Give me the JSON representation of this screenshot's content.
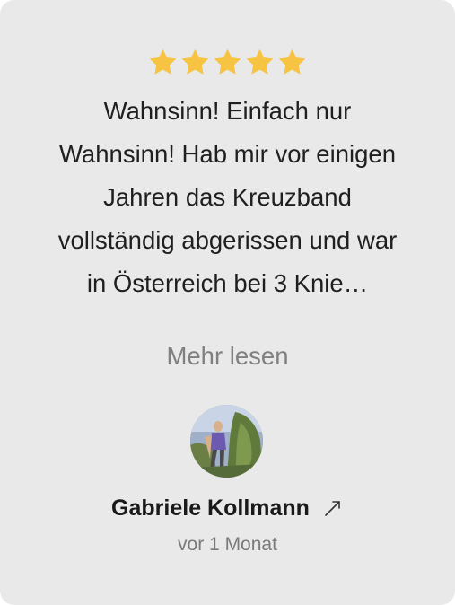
{
  "review": {
    "rating": 5,
    "text": "Wahnsinn! Einfach nur Wahnsinn! Hab mir vor einigen Jahren das Kreuzband vollständig abgerissen und war in Österreich bei 3 Knie…",
    "more_label": "Mehr lesen"
  },
  "author": {
    "name": "Gabriele Kollmann",
    "date": "vor 1 Monat",
    "link_icon": "external-link-arrow-icon"
  },
  "colors": {
    "card_background": "#e9e9e9",
    "star": "#f6c343",
    "text": "#1f1f1f",
    "muted": "#808080"
  }
}
